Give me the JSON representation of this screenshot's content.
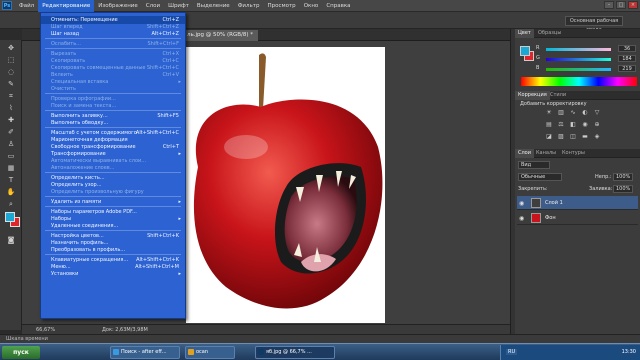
{
  "menubar": {
    "logo": "Ps",
    "items": [
      "Файл",
      "Редактирование",
      "Изображение",
      "Слои",
      "Шрифт",
      "Выделение",
      "Фильтр",
      "Просмотр",
      "Окно",
      "Справка"
    ],
    "active_index": 1
  },
  "options": {
    "workspace": "Основная рабочая среда"
  },
  "document": {
    "tab": "ль.jpg @ 50% (RGB/8) *",
    "zoom": "66,67%",
    "size": "Док: 2,63M/3,98M"
  },
  "edit_menu": [
    {
      "label": "Отменить: Перемещение",
      "shortcut": "Ctrl+Z"
    },
    {
      "label": "Шаг вперед",
      "shortcut": "Shift+Ctrl+Z",
      "disabled": true
    },
    {
      "label": "Шаг назад",
      "shortcut": "Alt+Ctrl+Z"
    },
    {
      "sep": true
    },
    {
      "label": "Ослабить...",
      "shortcut": "Shift+Ctrl+F",
      "disabled": true
    },
    {
      "sep": true
    },
    {
      "label": "Вырезать",
      "shortcut": "Ctrl+X",
      "disabled": true
    },
    {
      "label": "Скопировать",
      "shortcut": "Ctrl+C",
      "disabled": true
    },
    {
      "label": "Скопировать совмещенные данные",
      "shortcut": "Shift+Ctrl+C",
      "disabled": true
    },
    {
      "label": "Вклеить",
      "shortcut": "Ctrl+V",
      "disabled": true
    },
    {
      "label": "Специальная вставка",
      "arrow": true,
      "disabled": true
    },
    {
      "label": "Очистить",
      "disabled": true
    },
    {
      "sep": true
    },
    {
      "label": "Проверка орфографии...",
      "disabled": true
    },
    {
      "label": "Поиск и замена текста...",
      "disabled": true
    },
    {
      "sep": true
    },
    {
      "label": "Выполнить заливку...",
      "shortcut": "Shift+F5"
    },
    {
      "label": "Выполнить обводку..."
    },
    {
      "sep": true
    },
    {
      "label": "Масштаб с учетом содержимого",
      "shortcut": "Alt+Shift+Ctrl+C"
    },
    {
      "label": "Марионеточная деформация"
    },
    {
      "label": "Свободное трансформирование",
      "shortcut": "Ctrl+T"
    },
    {
      "label": "Трансформирование",
      "arrow": true
    },
    {
      "label": "Автоматически выравнивать слои...",
      "disabled": true
    },
    {
      "label": "Автоналожение слоев...",
      "disabled": true
    },
    {
      "sep": true
    },
    {
      "label": "Определить кисть..."
    },
    {
      "label": "Определить узор..."
    },
    {
      "label": "Определить произвольную фигуру",
      "disabled": true
    },
    {
      "sep": true
    },
    {
      "label": "Удалить из памяти",
      "arrow": true
    },
    {
      "sep": true
    },
    {
      "label": "Наборы параметров Adobe PDF..."
    },
    {
      "label": "Наборы",
      "arrow": true
    },
    {
      "label": "Удаленные соединения..."
    },
    {
      "sep": true
    },
    {
      "label": "Настройка цветов...",
      "shortcut": "Shift+Ctrl+K"
    },
    {
      "label": "Назначить профиль..."
    },
    {
      "label": "Преобразовать в профиль..."
    },
    {
      "sep": true
    },
    {
      "label": "Клавиатурные сокращения...",
      "shortcut": "Alt+Shift+Ctrl+K"
    },
    {
      "label": "Меню...",
      "shortcut": "Alt+Shift+Ctrl+M"
    },
    {
      "label": "Установки",
      "arrow": true
    }
  ],
  "color_panel": {
    "tabs": [
      "Цвет",
      "Образцы"
    ],
    "channels": [
      {
        "name": "R",
        "value": "36"
      },
      {
        "name": "G",
        "value": "184"
      },
      {
        "name": "B",
        "value": "219"
      }
    ],
    "fg": "#19a9d4",
    "bg": "#e0242a"
  },
  "adjust_panel": {
    "tabs": [
      "Коррекция",
      "Стили"
    ],
    "label": "Добавить корректировку"
  },
  "layers_panel": {
    "tabs": [
      "Слои",
      "Каналы",
      "Контуры"
    ],
    "kind": "Вид",
    "blend": "Обычные",
    "opacity_label": "Непр.:",
    "opacity": "100%",
    "lock_label": "Закрепить:",
    "fill_label": "Заливка:",
    "fill": "100%",
    "layers": [
      {
        "name": "Слой 1",
        "selected": true
      },
      {
        "name": "Фон",
        "selected": false
      }
    ]
  },
  "minibridge": {
    "label": "Шкала времени"
  },
  "taskbar": {
    "start": "пуск",
    "tasks": [
      "Поиск - after eff...",
      "ocan",
      "яб.jpg @ 66,7% ..."
    ],
    "lang": "RU",
    "time": "13:30"
  }
}
